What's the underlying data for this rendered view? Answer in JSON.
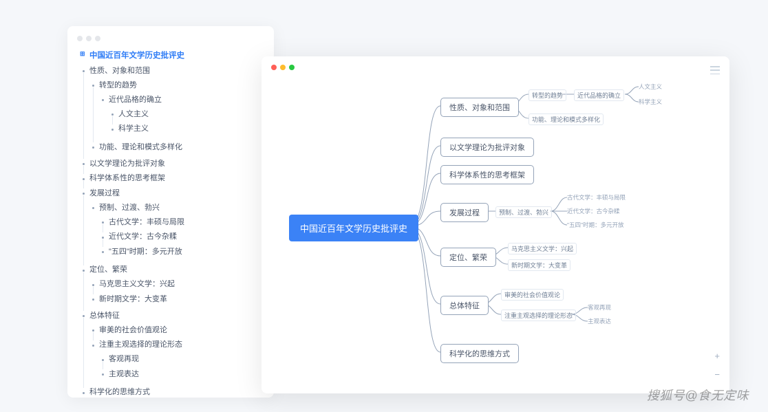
{
  "outline": {
    "title": "中国近百年文学历史批评史",
    "items": [
      {
        "label": "性质、对象和范围",
        "children": [
          {
            "label": "转型的趋势",
            "children": [
              {
                "label": "近代品格的确立",
                "children": [
                  {
                    "label": "人文主义"
                  },
                  {
                    "label": "科学主义"
                  }
                ]
              }
            ]
          },
          {
            "label": "功能、理论和模式多样化"
          }
        ]
      },
      {
        "label": "以文学理论为批评对象"
      },
      {
        "label": "科学体系性的思考框架"
      },
      {
        "label": "发展过程",
        "children": [
          {
            "label": "预制、过渡、勃兴",
            "children": [
              {
                "label": "古代文学：丰硕与局限"
              },
              {
                "label": "近代文学：古今杂糅"
              },
              {
                "label": "\"五四\"时期：多元开放"
              }
            ]
          }
        ]
      },
      {
        "label": "定位、繁荣",
        "children": [
          {
            "label": "马克思主义文学：兴起"
          },
          {
            "label": "新时期文学：大变革"
          }
        ]
      },
      {
        "label": "总体特征",
        "children": [
          {
            "label": "审美的社会价值观论"
          },
          {
            "label": "注重主观选择的理论形态",
            "children": [
              {
                "label": "客观再现"
              },
              {
                "label": "主观表达"
              }
            ]
          }
        ]
      },
      {
        "label": "科学化的思维方式"
      }
    ]
  },
  "mindmap": {
    "root": "中国近百年文学历史批评史",
    "branches": [
      {
        "label": "性质、对象和范围",
        "children": [
          {
            "label": "转型的趋势",
            "children": [
              {
                "label": "近代品格的确立",
                "children": [
                  {
                    "label": "人文主义"
                  },
                  {
                    "label": "科学主义"
                  }
                ]
              }
            ]
          },
          {
            "label": "功能、理论和模式多样化"
          }
        ]
      },
      {
        "label": "以文学理论为批评对象"
      },
      {
        "label": "科学体系性的思考框架"
      },
      {
        "label": "发展过程",
        "children": [
          {
            "label": "预制、过渡、勃兴",
            "children": [
              {
                "label": "古代文学：丰硕与局限"
              },
              {
                "label": "近代文学：古今杂糅"
              },
              {
                "label": "\"五四\"时期：多元开放"
              }
            ]
          }
        ]
      },
      {
        "label": "定位、繁荣",
        "children": [
          {
            "label": "马克思主义文学：兴起"
          },
          {
            "label": "新时期文学：大变革"
          }
        ]
      },
      {
        "label": "总体特征",
        "children": [
          {
            "label": "审美的社会价值观论"
          },
          {
            "label": "注重主观选择的理论形态",
            "children": [
              {
                "label": "客观再现"
              },
              {
                "label": "主观表达"
              }
            ]
          }
        ]
      },
      {
        "label": "科学化的思维方式"
      }
    ]
  },
  "watermark": "搜狐号@食无定味",
  "zoom": {
    "in": "+",
    "out": "−"
  }
}
